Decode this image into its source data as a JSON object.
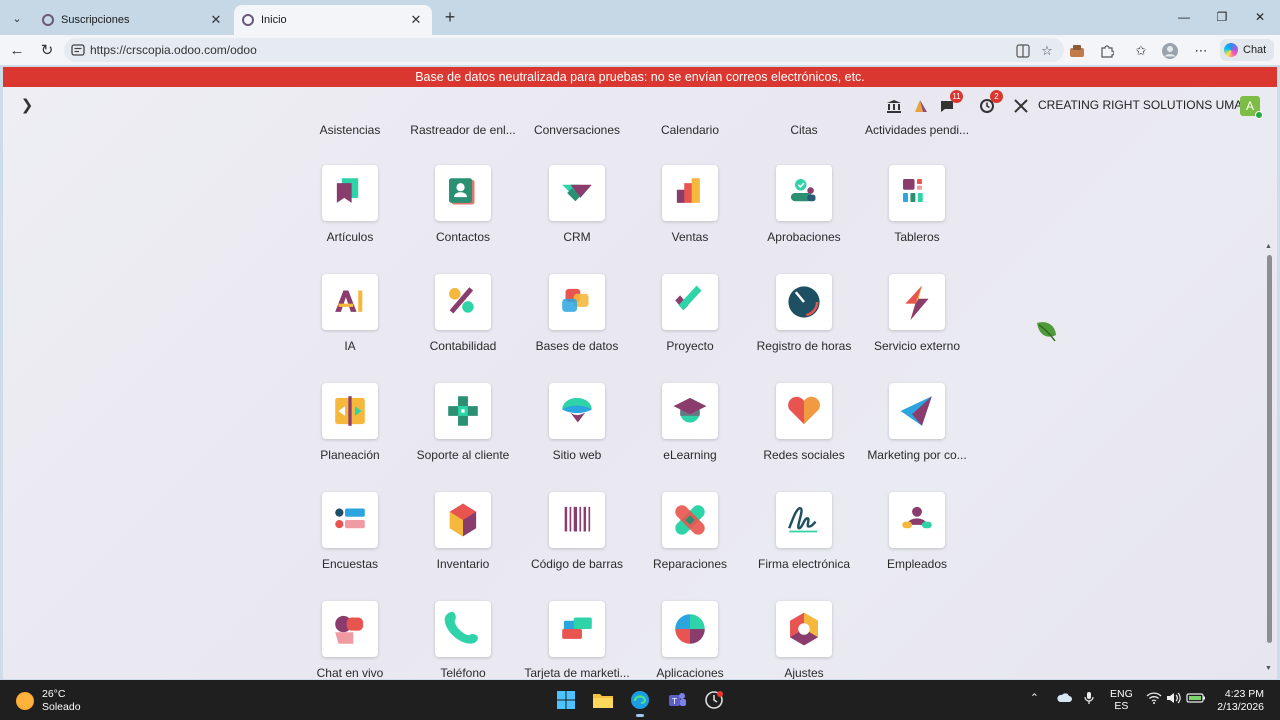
{
  "browser": {
    "tabs": [
      {
        "title": "Suscripciones",
        "active": false
      },
      {
        "title": "Inicio",
        "active": true
      }
    ],
    "url": "https://crscopia.odoo.com/odoo",
    "chat_label": "Chat"
  },
  "odoo": {
    "banner": "Base de datos neutralizada para pruebas: no se envían correos electrónicos, etc.",
    "company": "CREATING RIGHT SOLUTIONS UMAA",
    "avatar_letter": "A",
    "messages_count": "11",
    "activities_count": "2",
    "top_row_labels": [
      "Asistencias",
      "Rastreador de enl...",
      "Conversaciones",
      "Calendario",
      "Citas",
      "Actividades pendi..."
    ],
    "apps": [
      {
        "label": "Artículos",
        "icon": "articles-icon"
      },
      {
        "label": "Contactos",
        "icon": "contacts-icon"
      },
      {
        "label": "CRM",
        "icon": "crm-icon"
      },
      {
        "label": "Ventas",
        "icon": "sales-icon"
      },
      {
        "label": "Aprobaciones",
        "icon": "approvals-icon"
      },
      {
        "label": "Tableros",
        "icon": "dashboards-icon"
      },
      {
        "label": "IA",
        "icon": "ai-icon"
      },
      {
        "label": "Contabilidad",
        "icon": "accounting-icon"
      },
      {
        "label": "Bases de datos",
        "icon": "databases-icon"
      },
      {
        "label": "Proyecto",
        "icon": "project-icon"
      },
      {
        "label": "Registro de horas",
        "icon": "timesheets-icon"
      },
      {
        "label": "Servicio externo",
        "icon": "field-service-icon"
      },
      {
        "label": "Planeación",
        "icon": "planning-icon"
      },
      {
        "label": "Soporte al cliente",
        "icon": "helpdesk-icon"
      },
      {
        "label": "Sitio web",
        "icon": "website-icon"
      },
      {
        "label": "eLearning",
        "icon": "elearning-icon"
      },
      {
        "label": "Redes sociales",
        "icon": "social-icon"
      },
      {
        "label": "Marketing por co...",
        "icon": "email-marketing-icon"
      },
      {
        "label": "Encuestas",
        "icon": "surveys-icon"
      },
      {
        "label": "Inventario",
        "icon": "inventory-icon"
      },
      {
        "label": "Código de barras",
        "icon": "barcode-icon"
      },
      {
        "label": "Reparaciones",
        "icon": "repairs-icon"
      },
      {
        "label": "Firma electrónica",
        "icon": "sign-icon"
      },
      {
        "label": "Empleados",
        "icon": "employees-icon"
      },
      {
        "label": "Chat en vivo",
        "icon": "livechat-icon"
      },
      {
        "label": "Teléfono",
        "icon": "phone-icon"
      },
      {
        "label": "Tarjeta de marketi...",
        "icon": "marketing-card-icon"
      },
      {
        "label": "Aplicaciones",
        "icon": "apps-icon"
      },
      {
        "label": "Ajustes",
        "icon": "settings-icon"
      }
    ]
  },
  "taskbar": {
    "weather_temp": "26°C",
    "weather_desc": "Soleado",
    "lang_top": "ENG",
    "lang_bottom": "ES",
    "time": "4:23 PM",
    "date": "2/13/2026"
  }
}
